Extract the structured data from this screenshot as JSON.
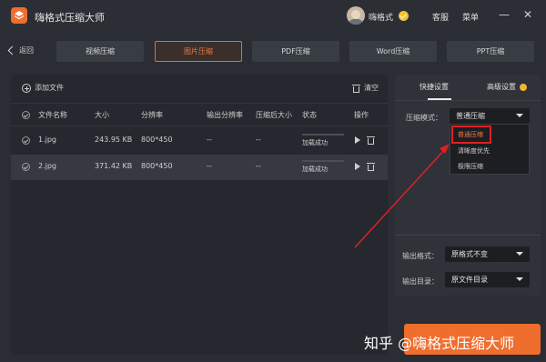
{
  "app": {
    "title": "嗨格式压缩大师",
    "username": "嗨格式",
    "service": "客服",
    "menu": "菜单"
  },
  "nav": {
    "back": "返回",
    "tabs": [
      "视频压缩",
      "图片压缩",
      "PDF压缩",
      "Word压缩",
      "PPT压缩"
    ],
    "active_tab": "图片压缩"
  },
  "toolbar": {
    "add_file": "添加文件",
    "clear": "清空"
  },
  "table": {
    "headers": [
      "文件名称",
      "大小",
      "分辨率",
      "输出分辨率",
      "压缩后大小",
      "状态",
      "操作"
    ],
    "rows": [
      {
        "name": "1.jpg",
        "size": "243.95 KB",
        "resolution": "800*450",
        "out_resolution": "--",
        "out_size": "--",
        "status": "加载成功"
      },
      {
        "name": "2.jpg",
        "size": "371.42 KB",
        "resolution": "800*450",
        "out_resolution": "--",
        "out_size": "--",
        "status": "加载成功"
      }
    ]
  },
  "settings": {
    "tabs": [
      "快捷设置",
      "高级设置"
    ],
    "mode_label": "压缩模式：",
    "mode_value": "普通压缩",
    "mode_options": [
      "普通压缩",
      "清晰度优先",
      "极限压缩"
    ],
    "format_label": "输出格式：",
    "format_value": "原格式不变",
    "dir_label": "输出目录：",
    "dir_value": "原文件目录"
  },
  "watermark": "知乎 @嗨格式压缩大师",
  "colors": {
    "accent": "#ef6d2d",
    "highlight_box": "#e02020",
    "arrow": "#e02020"
  }
}
